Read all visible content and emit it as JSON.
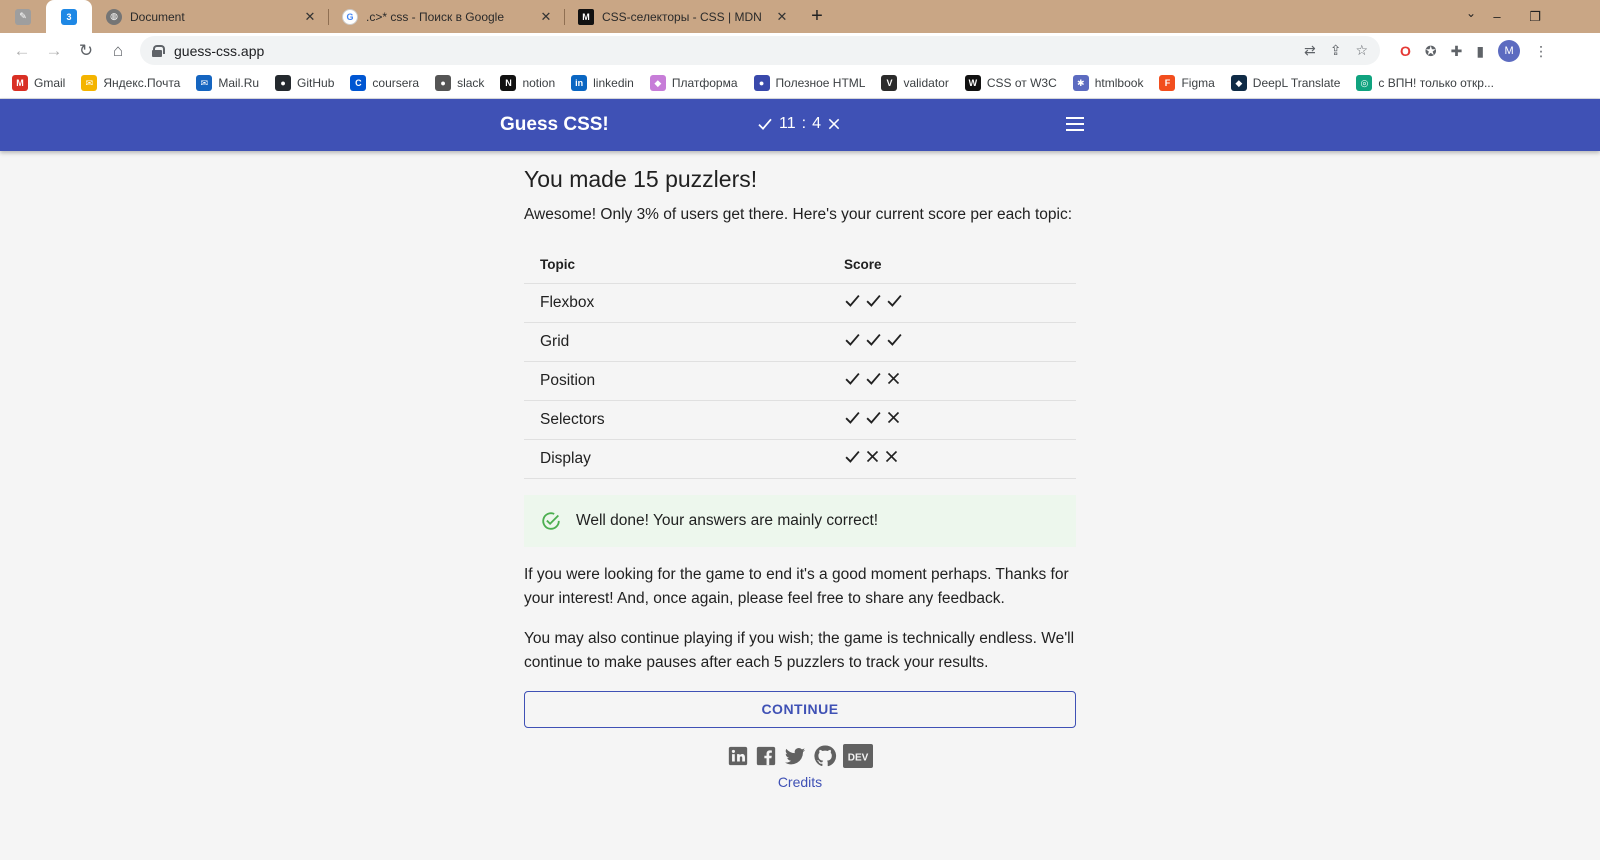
{
  "browser": {
    "tabs": [
      {
        "title": "Document",
        "icon": "globe-icon"
      },
      {
        "title": ".c>* css - Поиск в Google",
        "icon": "google-icon"
      },
      {
        "title": "CSS-селекторы - CSS | MDN",
        "icon": "mdn-icon"
      }
    ],
    "new_tab_label": "+",
    "url": "guess-css.app",
    "profile_initial": "M",
    "bookmarks": [
      {
        "label": "Gmail",
        "color": "#d93025",
        "glyph": "M"
      },
      {
        "label": "Яндекс.Почта",
        "color": "#f4b400",
        "glyph": "✉"
      },
      {
        "label": "Mail.Ru",
        "color": "#1565c0",
        "glyph": "✉"
      },
      {
        "label": "GitHub",
        "color": "#24292e",
        "glyph": "●"
      },
      {
        "label": "coursera",
        "color": "#0056d2",
        "glyph": "C"
      },
      {
        "label": "slack",
        "color": "#555555",
        "glyph": "●"
      },
      {
        "label": "notion",
        "color": "#111111",
        "glyph": "N"
      },
      {
        "label": "linkedin",
        "color": "#0a66c2",
        "glyph": "in"
      },
      {
        "label": "Платформа",
        "color": "#c77dd8",
        "glyph": "◆"
      },
      {
        "label": "Полезное HTML",
        "color": "#3949ab",
        "glyph": "●"
      },
      {
        "label": "validator",
        "color": "#2b2b2b",
        "glyph": "V"
      },
      {
        "label": "CSS от W3C",
        "color": "#111111",
        "glyph": "W"
      },
      {
        "label": "htmlbook",
        "color": "#5c6bc0",
        "glyph": "✱"
      },
      {
        "label": "Figma",
        "color": "#f24e1e",
        "glyph": "F"
      },
      {
        "label": "DeepL Translate",
        "color": "#0f2b46",
        "glyph": "◆"
      },
      {
        "label": "с ВПН! только откр...",
        "color": "#10a37f",
        "glyph": "◎"
      }
    ]
  },
  "header": {
    "title": "Guess CSS!",
    "correct": "11",
    "separator": ":",
    "wrong": "4"
  },
  "main": {
    "title": "You made 15 puzzlers!",
    "intro": "Awesome! Only 3% of users get there. Here's your current score per each topic:",
    "table": {
      "headers": [
        "Topic",
        "Score"
      ],
      "rows": [
        {
          "topic": "Flexbox",
          "score": [
            "check",
            "check",
            "check"
          ]
        },
        {
          "topic": "Grid",
          "score": [
            "check",
            "check",
            "check"
          ]
        },
        {
          "topic": "Position",
          "score": [
            "check",
            "check",
            "cross"
          ]
        },
        {
          "topic": "Selectors",
          "score": [
            "check",
            "check",
            "cross"
          ]
        },
        {
          "topic": "Display",
          "score": [
            "check",
            "cross",
            "cross"
          ]
        }
      ]
    },
    "alert": "Well done! Your answers are mainly correct!",
    "paragraph1": "If you were looking for the game to end it's a good moment perhaps. Thanks for your interest! And, once again, please feel free to share any feedback.",
    "paragraph2": "You may also continue playing if you wish; the game is technically endless. We'll continue to make pauses after each 5 puzzlers to track your results.",
    "continue_label": "CONTINUE",
    "socials": [
      "linkedin-icon",
      "facebook-icon",
      "twitter-icon",
      "github-icon",
      "dev-icon"
    ],
    "dev_label": "DEV",
    "credits_label": "Credits"
  },
  "colors": {
    "primary": "#3f51b5",
    "success_bg": "#edf7ed",
    "success_icon": "#4caf50",
    "tabbar": "#c9a685",
    "page_bg": "#f5f5f5"
  }
}
